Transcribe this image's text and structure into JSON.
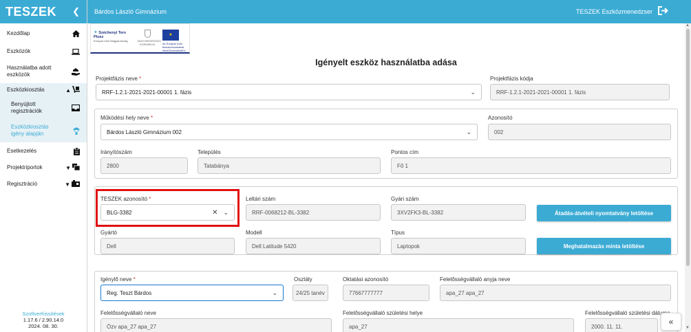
{
  "sidebar": {
    "logo": "TESZEK",
    "collapse_icon": "chevron-left-icon",
    "items": [
      {
        "label": "Kezdőlap",
        "icon": "home-icon"
      },
      {
        "label": "Eszközök",
        "icon": "laptop-icon"
      },
      {
        "label": "Használatba adott eszközök",
        "icon": "hand-device-icon"
      },
      {
        "label": "Eszközkiosztás",
        "icon": "dolly-icon"
      },
      {
        "label": "Benyújtott regisztrációk",
        "icon": "inbox-icon"
      },
      {
        "label": "Eszközkiosztás igény alapján",
        "icon": "parachute-icon"
      },
      {
        "label": "Esetkezelés",
        "icon": "clipboard-icon"
      },
      {
        "label": "Projektriportok",
        "icon": "report-icon"
      },
      {
        "label": "Regisztráció",
        "icon": "registration-icon"
      }
    ],
    "version": {
      "link": "Szoftverfrissítések",
      "number": "1.17.6 / 2.90.14.0",
      "date": "2024. 08. 30."
    }
  },
  "header": {
    "school": "Bárdos László Gimnázium",
    "app_name": "TESZEK Eszközmenedzser",
    "logout_icon": "logout-icon"
  },
  "banner": {
    "szechenyi": "Széchenyi Terv Plusz",
    "szechenyi_sub": "Európai Unió Magyarország",
    "hu": "MAGYARORSZÁG KORMÁNYA",
    "eu": "Az Európai Unió finanszírozásával NextGenerationEU"
  },
  "page": {
    "title": "Igényelt eszköz használatba adása"
  },
  "form": {
    "projektfazis_neve_label": "Projektfázis neve",
    "projektfazis_neve_value": "RRF-1.2.1-2021-2021-00001 1. fázis",
    "projektfazis_kodja_label": "Projektfázis kódja",
    "projektfazis_kodja_value": "RRF-1.2.1-2021-2021-00001 1. fázis",
    "mukodesi_hely_label": "Működési hely neve",
    "mukodesi_hely_value": "Bárdos László Gimnázium 002",
    "azonosito_label": "Azonosító",
    "azonosito_value": "002",
    "iranyitoszam_label": "Irányítószám",
    "iranyitoszam_value": "2800",
    "telepules_label": "Település",
    "telepules_value": "Tatabánya",
    "pontos_cim_label": "Pontos cím",
    "pontos_cim_value": "Fő 1",
    "teszek_azonosito_label": "TESZEK azonosító",
    "teszek_azonosito_value": "BLG-3382",
    "leltari_szam_label": "Leltári szám",
    "leltari_szam_value": "RRF-0068212-BL-3382",
    "gyari_szam_label": "Gyári szám",
    "gyari_szam_value": "3XV2FK3-BL-3382",
    "atadas_button": "Átadás-átvételi nyomtatvány letöltése",
    "gyarto_label": "Gyártó",
    "gyarto_value": "Dell",
    "modell_label": "Modell",
    "modell_value": "Dell Latitude 5420",
    "tipus_label": "Típus",
    "tipus_value": "Laptopok",
    "meghatalmazas_button": "Meghatalmazás minta letöltése",
    "igenylo_neve_label": "Igénylő neve",
    "igenylo_neve_value": "Reg. Teszt Bárdos",
    "osztaly_label": "Osztály",
    "osztaly_value": "24/25 tanév",
    "oktatasi_azonosito_label": "Oktatási azonosító",
    "oktatasi_azonosito_value": "77667777777",
    "anyja_neve_label": "Felelősségvállaló anyja neve",
    "anyja_neve_value": "apa_27 apa_27",
    "felelos_neve_label": "Felelősségvállaló neve",
    "felelos_neve_value": "Özv apa_27 apa_27",
    "szuletesi_helye_label": "Felelősségvállaló születési helye",
    "szuletesi_helye_value": "apa_27",
    "szuletesi_datuma_label": "Felelősségvállaló születési dátuma",
    "szuletesi_datuma_value": "2000. 11. 11."
  },
  "fab_icon": "double-chevron-left-icon",
  "colors": {
    "accent": "#3babd4",
    "highlight": "#e01010",
    "required": "#d32f2f",
    "focus": "#1976d2"
  }
}
